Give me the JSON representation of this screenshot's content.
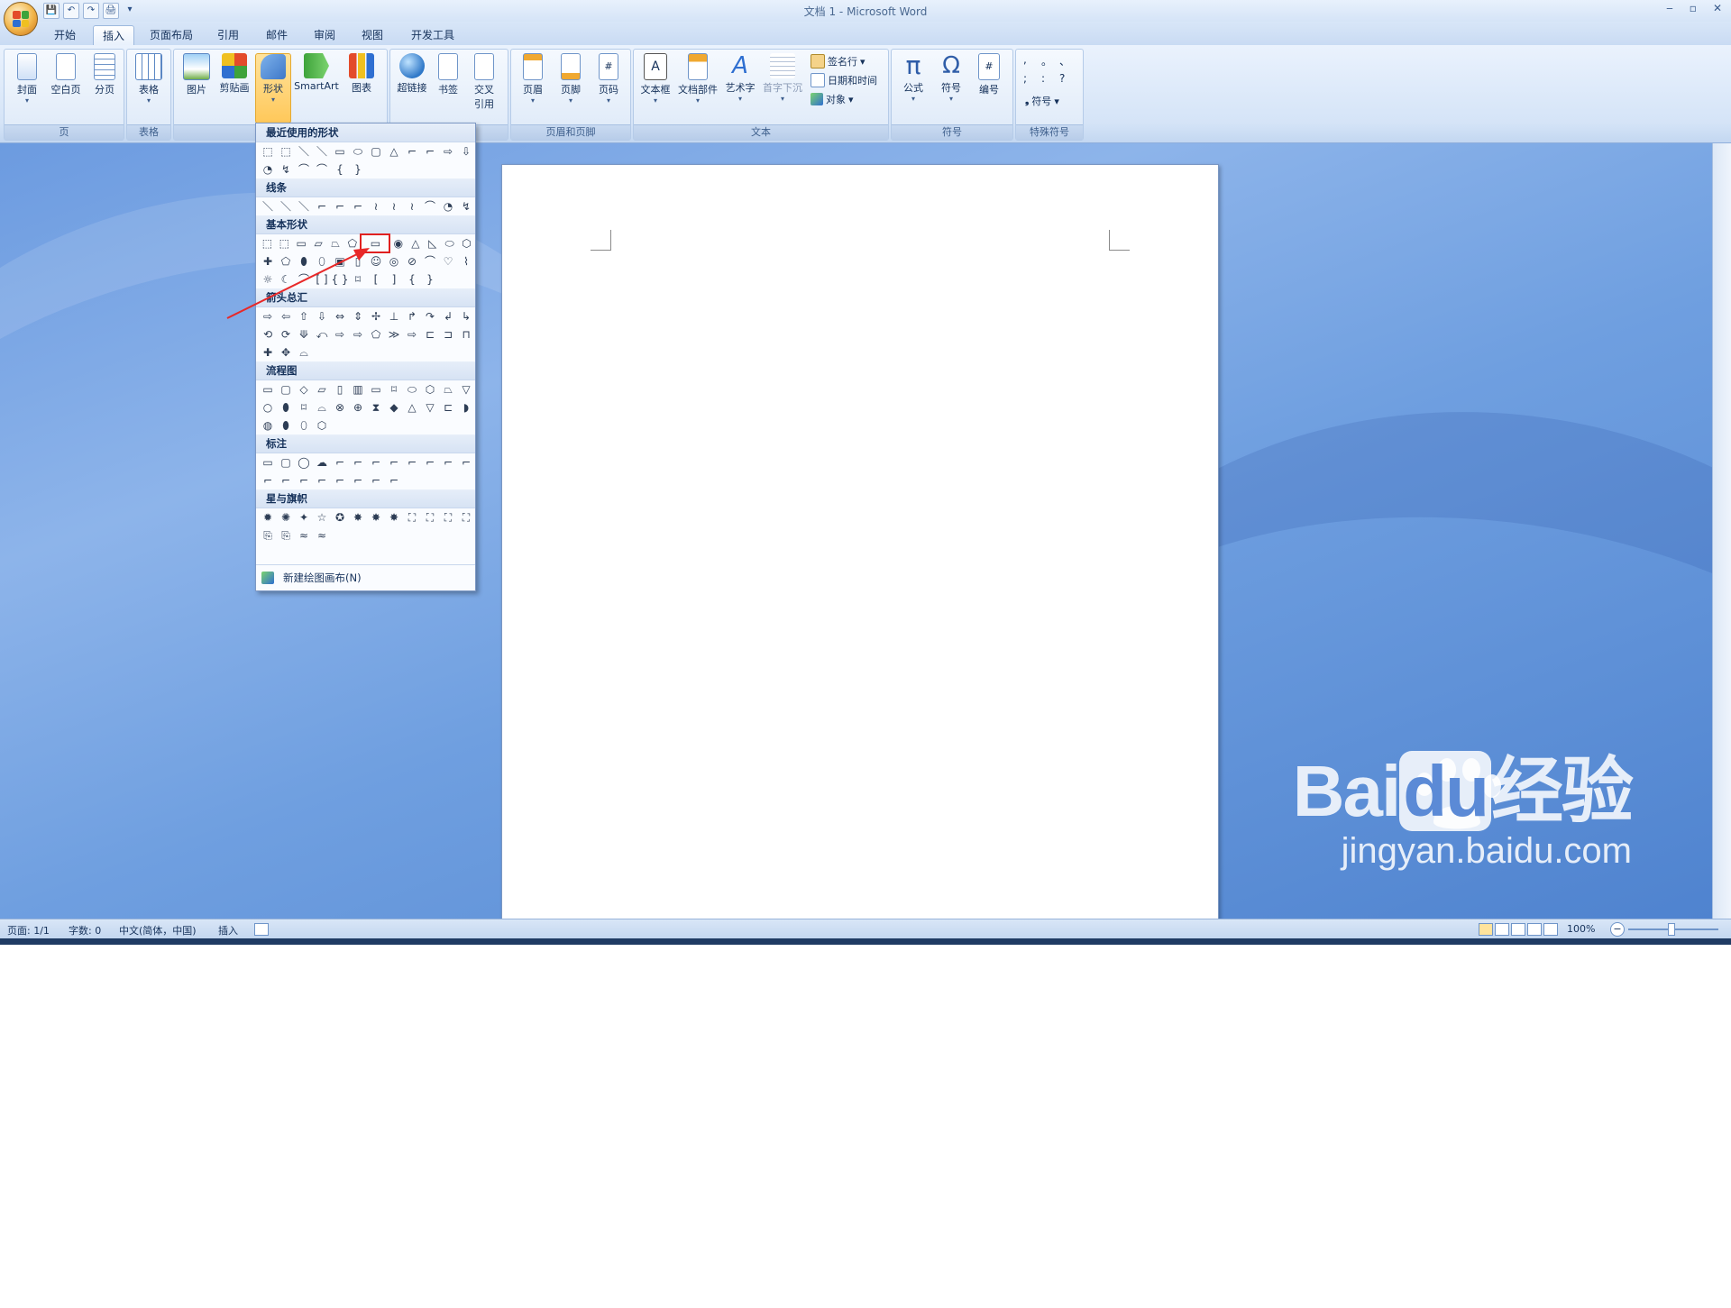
{
  "window": {
    "title": "文档 1 - Microsoft Word",
    "controls": [
      "‒",
      "▫",
      "✕"
    ]
  },
  "qat": [
    "💾",
    "↶",
    "↷",
    "🖨",
    "▾"
  ],
  "tabs": [
    "开始",
    "插入",
    "页面布局",
    "引用",
    "邮件",
    "审阅",
    "视图",
    "开发工具"
  ],
  "ribbon": {
    "groups": [
      "页",
      "表格",
      "",
      "",
      "页眉和页脚",
      "文本",
      "符号",
      "特殊符号"
    ],
    "buttons": {
      "cover": "封面",
      "blank": "空白页",
      "pagebreak": "分页",
      "table": "表格",
      "picture": "图片",
      "clipart": "剪贴画",
      "shapes": "形状",
      "smartart": "SmartArt",
      "chart": "图表",
      "hyperlink": "超链接",
      "bookmark": "书签",
      "crossref1": "交叉",
      "crossref2": "引用",
      "header": "页眉",
      "footer": "页脚",
      "pagenum": "页码",
      "textbox": "文本框",
      "docparts": "文档部件",
      "wordart": "艺术字",
      "dropcap": "首字下沉",
      "signature": "签名行",
      "datetime": "日期和时间",
      "object": "对象",
      "equation": "公式",
      "symbol": "符号",
      "numbering": "编号",
      "specialsym": "符号"
    },
    "icon_glyphs": {
      "pi": "π",
      "omega": "Ω",
      "hash": "#",
      "textA": "A"
    },
    "special_chars": [
      ",",
      "。",
      "、",
      ";",
      ":",
      "?"
    ]
  },
  "shapes_menu": {
    "sections": [
      "最近使用的形状",
      "线条",
      "基本形状",
      "箭头总汇",
      "流程图",
      "标注",
      "星与旗帜"
    ],
    "new_canvas": "新建绘图画布(N)",
    "recent": [
      [
        "⬚",
        "⬚",
        "＼",
        "＼",
        "▭",
        "⬭",
        "▢",
        "△",
        "⌐",
        "⌐",
        "⇨",
        "⇩"
      ],
      [
        "◔",
        "↯",
        "⌒",
        "⌒",
        "{",
        "}"
      ]
    ],
    "lines": [
      [
        "＼",
        "＼",
        "＼",
        "⌐",
        "⌐",
        "⌐",
        "≀",
        "≀",
        "≀",
        "⌒",
        "◔",
        "↯"
      ]
    ],
    "basic": [
      [
        "⬚",
        "⬚",
        "▭",
        "▱",
        "⏢",
        "⬠",
        "▭",
        "◉",
        "△",
        "◺",
        "⬭",
        "⬡"
      ],
      [
        "✚",
        "⬠",
        "⬮",
        "⬯",
        "▣",
        "▯",
        "☺",
        "◎",
        "⊘",
        "⌒",
        "♡",
        "⌇"
      ],
      [
        "☼",
        "☾",
        "⌒",
        "[ ]",
        "{ }",
        "⌑",
        "[",
        "]",
        "{",
        "}"
      ]
    ],
    "arrows": [
      [
        "⇨",
        "⇦",
        "⇧",
        "⇩",
        "⇔",
        "⇕",
        "✢",
        "⊥",
        "↱",
        "↷",
        "↲",
        "↳"
      ],
      [
        "⟲",
        "⟳",
        "⟱",
        "⤺",
        "⇨",
        "⇨",
        "⬠",
        "≫",
        "⇨",
        "⊏",
        "⊐",
        "⊓"
      ],
      [
        "✚",
        "✥",
        "⌓"
      ]
    ],
    "flowchart": [
      [
        "▭",
        "▢",
        "◇",
        "▱",
        "▯",
        "▥",
        "▭",
        "⌑",
        "⬭",
        "⬡",
        "⏢",
        "▽"
      ],
      [
        "○",
        "⬮",
        "⌑",
        "⌓",
        "⊗",
        "⊕",
        "⧗",
        "◆",
        "△",
        "▽",
        "⊏",
        "◗"
      ],
      [
        "◍",
        "⬮",
        "⬯",
        "⬡"
      ]
    ],
    "callouts": [
      [
        "▭",
        "▢",
        "◯",
        "☁",
        "⌐",
        "⌐",
        "⌐",
        "⌐",
        "⌐",
        "⌐",
        "⌐",
        "⌐"
      ],
      [
        "⌐",
        "⌐",
        "⌐",
        "⌐",
        "⌐",
        "⌐",
        "⌐",
        "⌐"
      ]
    ],
    "stars": [
      [
        "✹",
        "✺",
        "✦",
        "☆",
        "✪",
        "✸",
        "✸",
        "✸",
        "⛶",
        "⛶",
        "⛶",
        "⛶"
      ],
      [
        "⎘",
        "⎘",
        "≈",
        "≈"
      ]
    ]
  },
  "status": {
    "page": "页面: 1/1",
    "words": "字数: 0",
    "lang": "中文(简体，中国)",
    "mode": "插入",
    "zoom": "100%"
  },
  "watermark": {
    "brand_a": "Bai",
    "brand_b": "du",
    "brand_c": "经验",
    "url": "jingyan.baidu.com"
  },
  "colors": {
    "ribbon_bg": "#dbe8f8",
    "workspace": "#6f9fe0",
    "highlight": "#e02020",
    "active_btn": "#ffcd66"
  }
}
